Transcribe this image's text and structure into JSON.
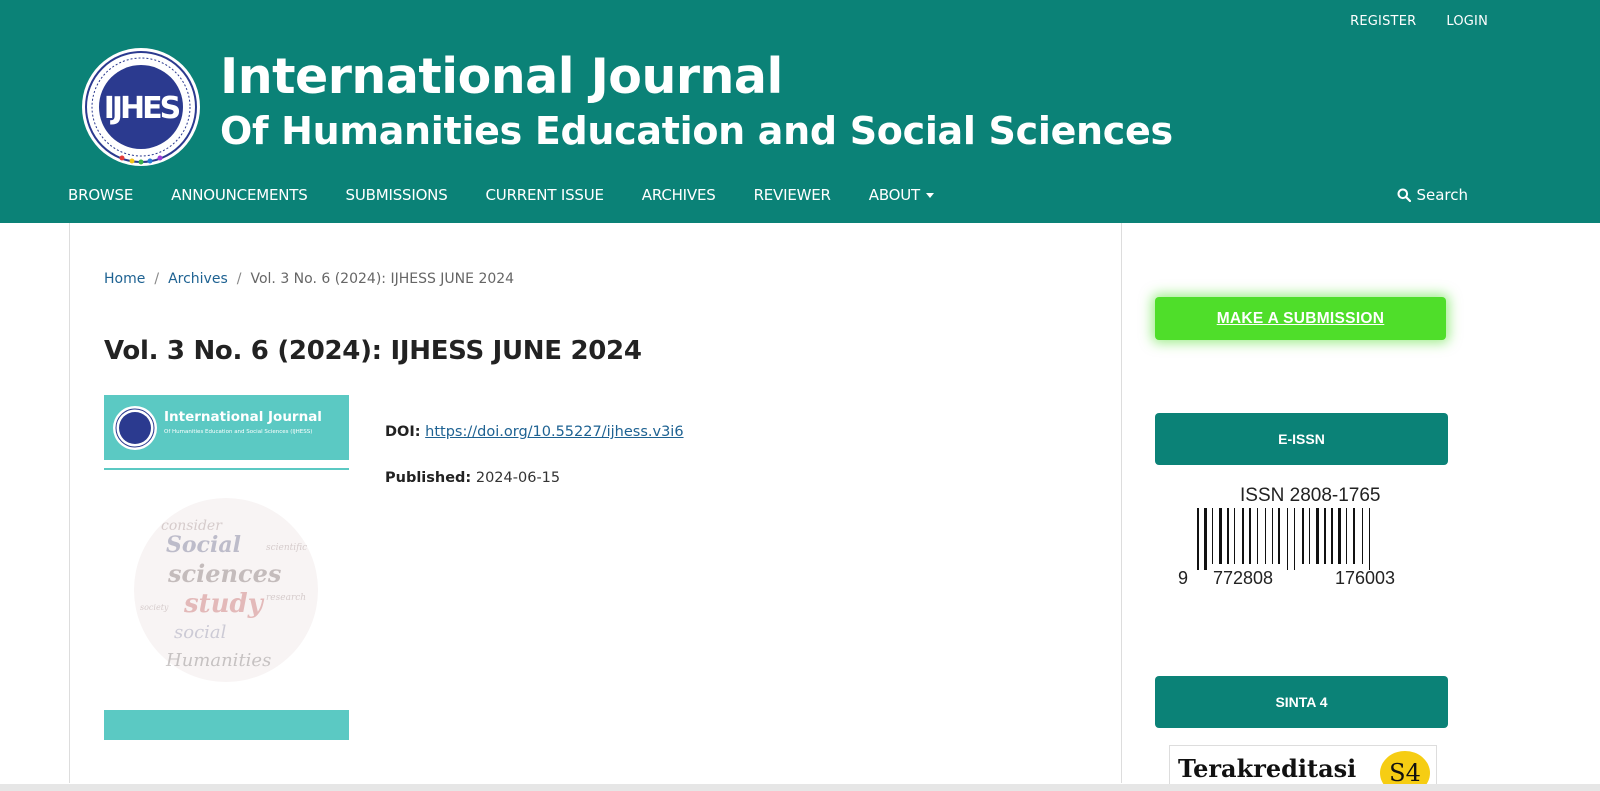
{
  "user_nav": {
    "register": "REGISTER",
    "login": "LOGIN"
  },
  "site": {
    "title_line1": "International Journal",
    "title_line2": "Of Humanities Education and Social Sciences",
    "logo_text": "IJHES"
  },
  "nav": {
    "items": [
      "BROWSE",
      "ANNOUNCEMENTS",
      "SUBMISSIONS",
      "CURRENT ISSUE",
      "ARCHIVES",
      "REVIEWER",
      "ABOUT"
    ],
    "search_label": "Search"
  },
  "breadcrumb": {
    "home": "Home",
    "archives": "Archives",
    "sep": "/",
    "current": "Vol. 3 No. 6 (2024): IJHESS JUNE 2024"
  },
  "issue": {
    "title": "Vol. 3 No. 6 (2024): IJHESS JUNE 2024",
    "doi_label": "DOI:",
    "doi_url": "https://doi.org/10.55227/ijhess.v3i6",
    "published_label": "Published:",
    "published_date": "2024-06-15"
  },
  "cover": {
    "title": "International Journal",
    "subtitle": "Of Humanities Education and Social Sciences (IJHESS)"
  },
  "sidebar": {
    "submit_label": "MAKE A SUBMISSION",
    "eissn_label": "E-ISSN",
    "issn_text": "ISSN 2808-1765",
    "barcode_digits": [
      "9",
      "772808",
      "176003"
    ],
    "sinta_label": "SINTA 4",
    "terakreditasi": "Terakreditasi",
    "sinta_badge": "S4"
  },
  "colors": {
    "header_bg": "#0b8277",
    "submit_green": "#4fde2a",
    "cover_teal": "#5bc9c3",
    "link_blue": "#1e6292"
  }
}
